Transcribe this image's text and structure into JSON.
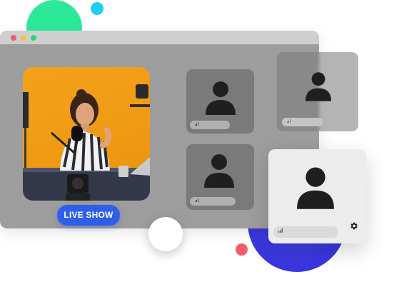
{
  "window": {
    "traffic_lights": [
      "#f45b6a",
      "#f5c242",
      "#35d175"
    ]
  },
  "feed": {
    "icon": "video-feed"
  },
  "live_button": {
    "label": "LIVE SHOW",
    "color": "#2f5fe8"
  },
  "record_button": {
    "icon": "record-button"
  },
  "participants": [
    {
      "icon": "user-icon",
      "status_icon": "signal-bars-icon"
    },
    {
      "icon": "user-icon",
      "status_icon": "signal-bars-icon"
    },
    {
      "icon": "user-icon",
      "status_icon": "signal-bars-icon"
    },
    {
      "icon": "user-icon",
      "status_icon": "signal-bars-icon",
      "settings_icon": "gear-icon"
    }
  ],
  "colors": {
    "accent_green": "#2ee89a",
    "accent_cyan": "#1fd0f0",
    "accent_blue": "#3b38e2",
    "accent_red": "#f45b6a"
  }
}
